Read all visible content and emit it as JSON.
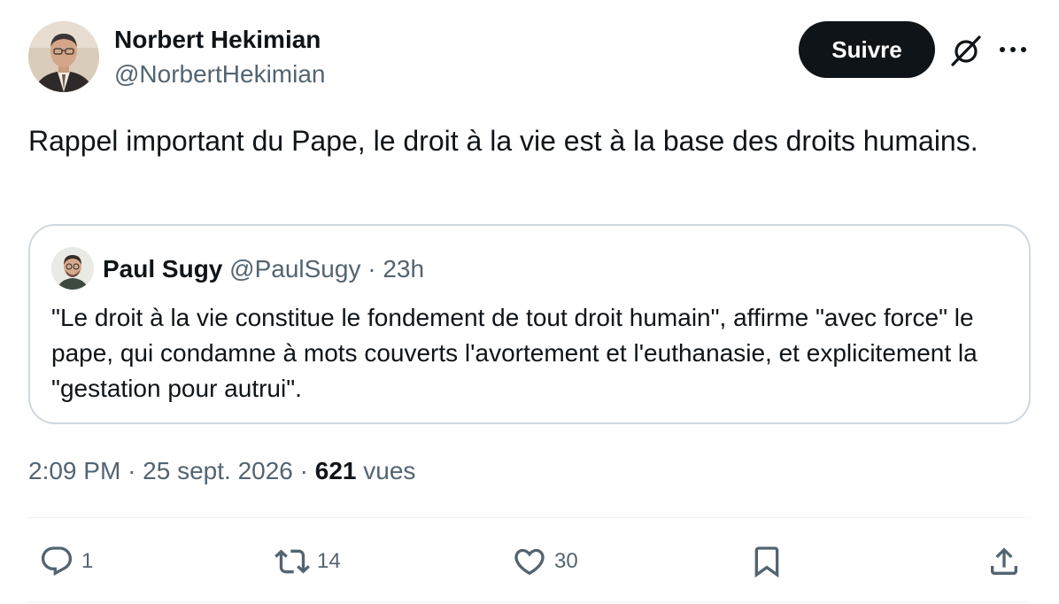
{
  "tweet": {
    "author": {
      "name": "Norbert Hekimian",
      "handle": "@NorbertHekimian"
    },
    "follow_label": "Suivre",
    "text": "Rappel important du Pape, le droit à la vie est à la base des droits humains.",
    "quote": {
      "name": "Paul Sugy",
      "handle": "@PaulSugy",
      "separator": "·",
      "time": "23h",
      "text": "\"Le droit à la vie constitue le fondement de tout droit humain\", affirme \"avec force\" le pape, qui condamne à mots couverts l'avortement et l'euthanasie, et explicitement la \"gestation pour autrui\"."
    },
    "meta": {
      "time": "2:09 PM",
      "separator": "·",
      "date": "25 sept. 2026",
      "views_count": "621",
      "views_label": "vues"
    },
    "actions": {
      "replies": "1",
      "reposts": "14",
      "likes": "30"
    }
  },
  "icons": [
    "grok-icon",
    "more-icon",
    "reply-icon",
    "repost-icon",
    "like-icon",
    "bookmark-icon",
    "share-icon"
  ],
  "colors": {
    "text": "#0f1419",
    "secondary": "#536471",
    "border": "#cfd9de",
    "follow_bg": "#0f1419"
  }
}
